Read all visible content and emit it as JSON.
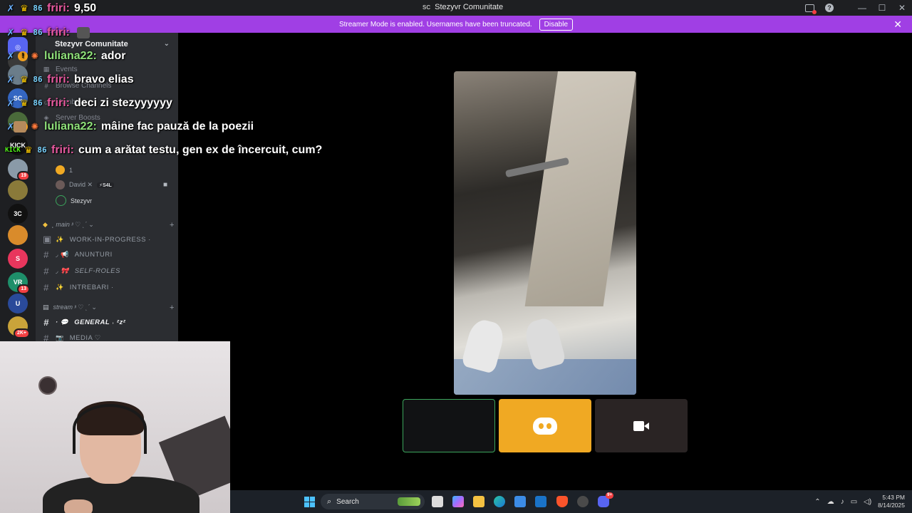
{
  "window": {
    "app_badge": "SC",
    "title": "Stezyvr Comunitate"
  },
  "banner": {
    "text": "Streamer Mode is enabled. Usernames have been truncated.",
    "button": "Disable",
    "close": "✕"
  },
  "server": {
    "name": "Stezyvr Comunitate",
    "chevron": "⌄",
    "menu": [
      {
        "icon": "calendar-icon",
        "label": "Events"
      },
      {
        "icon": "browse-icon",
        "label": "Browse Channels"
      },
      {
        "icon": "members-icon",
        "label": "Members"
      },
      {
        "icon": "boost-icon",
        "label": "Server Boosts"
      }
    ],
    "voice_users": [
      {
        "name": "1"
      },
      {
        "name": "David ✕",
        "tag": "⚡S4L"
      },
      {
        "name": "Stezyvr"
      }
    ],
    "categories": [
      {
        "label": "˛ main ᵎᵎ ♡ ˎˊ ⌄",
        "channels": [
          {
            "emoji": "✨",
            "name": "WORK-IN-PROGRESS ·"
          },
          {
            "emoji": "◞ 📢",
            "name": "ANUNTURI"
          },
          {
            "emoji": "◞ 🎀",
            "name": "SELF-ROLES"
          },
          {
            "emoji": "✨",
            "name": "INTREBARI ·"
          }
        ]
      },
      {
        "label": "stream ᵎᵎ ♡ ˎˊ ⌄",
        "channels": [
          {
            "emoji": "· 💬",
            "name": "GENERAL ˒ ᶻzᶻ"
          },
          {
            "emoji": "📷",
            "name": "MEDIA ♡"
          }
        ]
      }
    ]
  },
  "rail": {
    "servers": [
      {
        "label": "◎",
        "color": "#5865f2"
      },
      {
        "label": "",
        "color": "#3a3a3a"
      },
      {
        "label": "",
        "color": "#6b7d8a"
      },
      {
        "label": "SC",
        "color": "#3466c2"
      },
      {
        "label": "",
        "color": "#4a6a3a"
      },
      {
        "label": "KICK",
        "color": "#111"
      },
      {
        "label": "",
        "color": "#8a9aa8",
        "badge": "19"
      },
      {
        "label": "",
        "color": "#8a7a3a"
      },
      {
        "label": "3C",
        "color": "#111"
      },
      {
        "label": "",
        "color": "#d98b2b"
      },
      {
        "label": "S",
        "color": "#e8365d"
      },
      {
        "label": "VR",
        "color": "#1e8f6a",
        "badge": "13"
      },
      {
        "label": "U",
        "color": "#2a4a9a"
      },
      {
        "label": "",
        "color": "#c9a33a",
        "badge": "2K+"
      }
    ]
  },
  "chat": [
    {
      "badges": [
        "sword",
        "crown",
        "sub"
      ],
      "user": "friri:",
      "ucolor": "pink",
      "message": "9,50"
    },
    {
      "badges": [
        "sword",
        "crown",
        "sub"
      ],
      "user": "friri:",
      "ucolor": "pink",
      "message": "",
      "emote": true
    },
    {
      "badges": [
        "sword",
        "warn",
        "fire"
      ],
      "user": "luliana22:",
      "ucolor": "green",
      "message": "ador"
    },
    {
      "badges": [
        "sword",
        "crown",
        "sub"
      ],
      "user": "friri:",
      "ucolor": "pink",
      "message": "bravo elias"
    },
    {
      "badges": [
        "sword",
        "crown",
        "sub"
      ],
      "user": "friri:",
      "ucolor": "pink",
      "message": "deci zi stezyyyyyy"
    },
    {
      "badges": [
        "sword",
        "warn",
        "fire"
      ],
      "user": "luliana22:",
      "ucolor": "green",
      "message": "mâine fac pauză de la poezii",
      "emote_cat": true
    },
    {
      "badges": [
        "kick",
        "crown",
        "sub"
      ],
      "user": "friri:",
      "ucolor": "pink",
      "message": "cum a arătat testu, gen ex de încercuit, cum?"
    }
  ],
  "taskbar": {
    "search_placeholder": "Search",
    "time": "5:43 PM",
    "date": "8/14/2025",
    "discord_badge": "9+",
    "tray_chevron": "⌃"
  },
  "colors": {
    "banner": "#a03fe4",
    "accent_green": "#3ba55c",
    "tile_orange": "#f0a923"
  }
}
